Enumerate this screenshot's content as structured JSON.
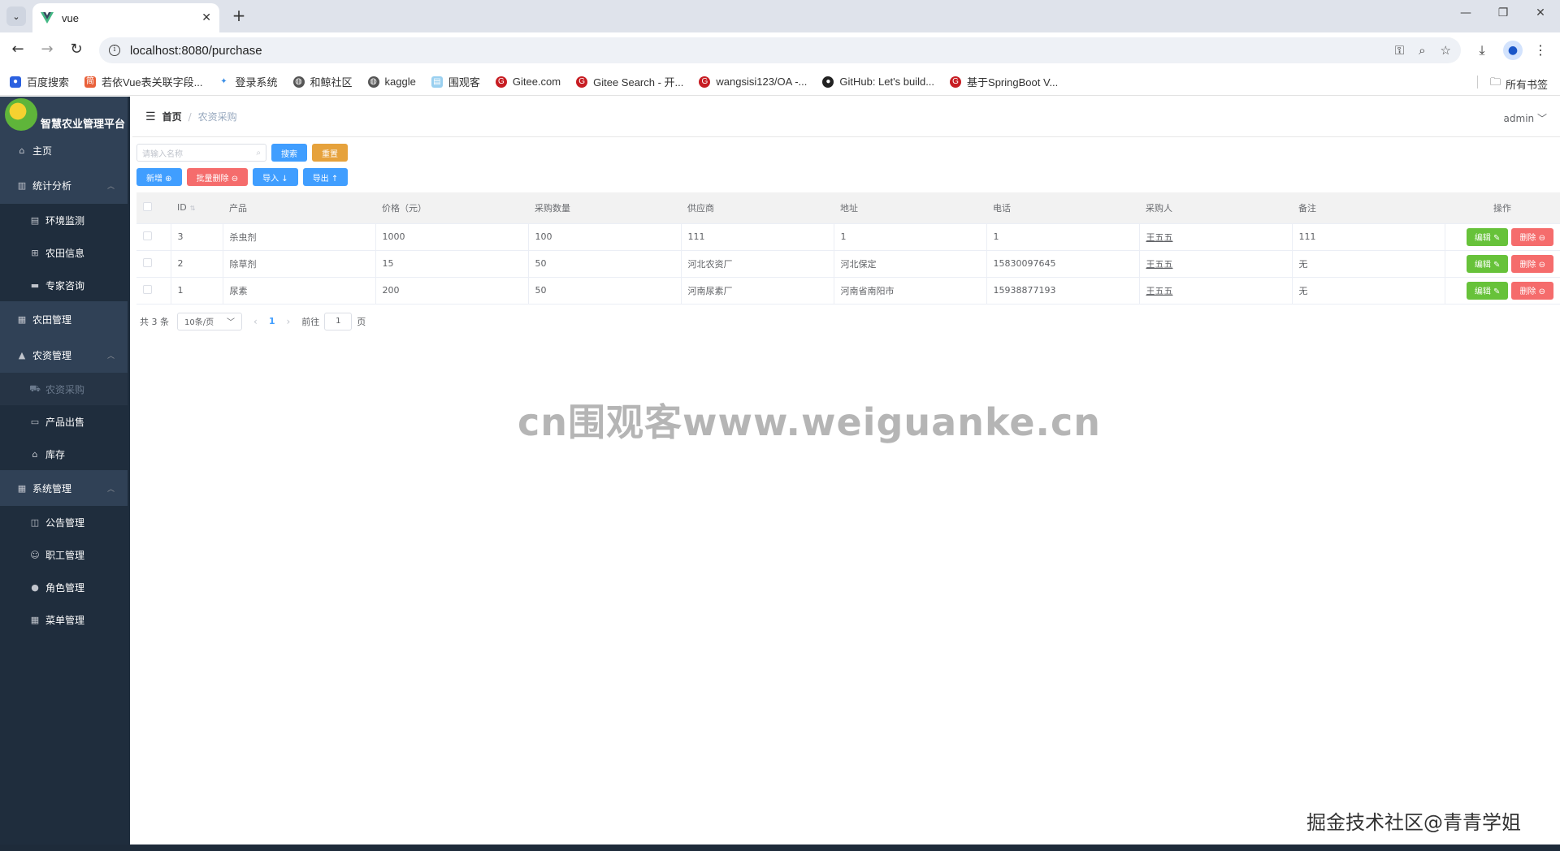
{
  "browser": {
    "tab_title": "vue",
    "url": "localhost:8080/purchase",
    "bookmarks": [
      "百度搜索",
      "若依Vue表关联字段...",
      "登录系统",
      "和鲸社区",
      "kaggle",
      "围观客",
      "Gitee.com",
      "Gitee Search - 开...",
      "wangsisi123/OA -...",
      "GitHub: Let's build...",
      "基于SpringBoot V..."
    ],
    "all_bookmarks": "所有书签"
  },
  "app": {
    "name": "智慧农业管理平台",
    "menu": {
      "home": "主页",
      "stats": "统计分析",
      "env": "环境监测",
      "field_info": "农田信息",
      "expert": "专家咨询",
      "field_mgmt": "农田管理",
      "supplies": "农资管理",
      "purchase": "农资采购",
      "sales": "产品出售",
      "stock": "库存",
      "system": "系统管理",
      "notice": "公告管理",
      "staff": "职工管理",
      "role": "角色管理",
      "menus": "菜单管理"
    },
    "breadcrumb": {
      "home": "首页",
      "current": "农资采购"
    },
    "user": "admin"
  },
  "toolbar": {
    "search_placeholder": "请输入名称",
    "search": "搜索",
    "reset": "重置",
    "add": "新增 ⊕",
    "batch_delete": "批量删除 ⊖",
    "import": "导入 ↓",
    "export": "导出 ↑"
  },
  "table": {
    "headers": [
      "ID",
      "产品",
      "价格（元）",
      "采购数量",
      "供应商",
      "地址",
      "电话",
      "采购人",
      "备注",
      "操作"
    ],
    "rows": [
      [
        "3",
        "杀虫剂",
        "1000",
        "100",
        "111",
        "1",
        "1",
        "王五五",
        "111"
      ],
      [
        "2",
        "除草剂",
        "15",
        "50",
        "河北农资厂",
        "河北保定",
        "15830097645",
        "王五五",
        "无"
      ],
      [
        "1",
        "尿素",
        "200",
        "50",
        "河南尿素厂",
        "河南省南阳市",
        "15938877193",
        "王五五",
        "无"
      ]
    ],
    "edit": "编辑 ✎",
    "delete": "删除 ⊖"
  },
  "pager": {
    "total": "共 3 条",
    "page_size": "10条/页",
    "current": "1",
    "goto": "前往",
    "goto_value": "1",
    "page_unit": "页"
  },
  "watermarks": {
    "center": "cn围观客www.weiguanke.cn",
    "corner": "掘金技术社区@青青学姐"
  }
}
